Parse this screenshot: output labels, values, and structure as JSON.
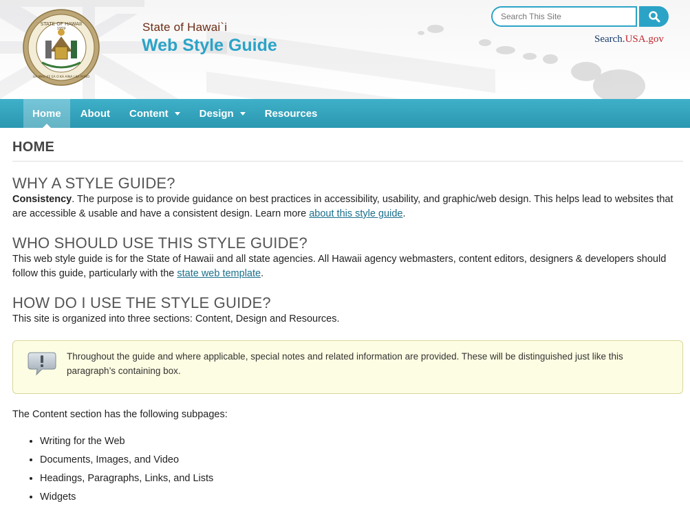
{
  "header": {
    "subtitle": "State of Hawai`i",
    "title": "Web Style Guide",
    "seal_text_top": "STATE OF HAWAII",
    "seal_year": "1959",
    "seal_motto": "UA MAU KE EA O KA AINA I KA PONO",
    "search": {
      "placeholder": "Search This Site"
    },
    "usagov": {
      "prefix": "Search.",
      "usa": "USA",
      "suffix": ".gov"
    }
  },
  "nav": {
    "items": [
      {
        "label": "Home"
      },
      {
        "label": "About"
      },
      {
        "label": "Content"
      },
      {
        "label": "Design"
      },
      {
        "label": "Resources"
      }
    ]
  },
  "main": {
    "page_title": "HOME",
    "sections": [
      {
        "heading": "WHY A STYLE GUIDE?",
        "bold": "Consistency",
        "text": ". The purpose is to provide guidance on best practices in accessibility, usability, and graphic/web design. This helps lead to websites that are accessible & usable and have a consistent design. Learn more ",
        "link": "about this style guide",
        "after": "."
      },
      {
        "heading": "WHO SHOULD USE THIS STYLE GUIDE?",
        "text": "This web style guide is for the State of Hawaii and all state agencies. All Hawaii agency webmasters, content editors, designers & developers should follow this guide, particularly with the ",
        "link": "state web template",
        "after": "."
      },
      {
        "heading": "HOW DO I USE THE STYLE GUIDE?",
        "text": "This site is organized into three sections: Content, Design and Resources."
      }
    ],
    "note": "Throughout the guide and where applicable, special notes and related information are provided. These will be distinguished just like this paragraph’s containing box.",
    "content_intro": "The Content section has the following subpages:",
    "content_list": [
      "Writing for the Web",
      "Documents, Images, and Video",
      "Headings, Paragraphs, Links, and Lists",
      "Widgets"
    ]
  },
  "colors": {
    "accent": "#2ba3c7",
    "nav_bg": "#3aa9c2",
    "subtitle": "#6b2b14",
    "note_bg": "#fdfde3"
  }
}
